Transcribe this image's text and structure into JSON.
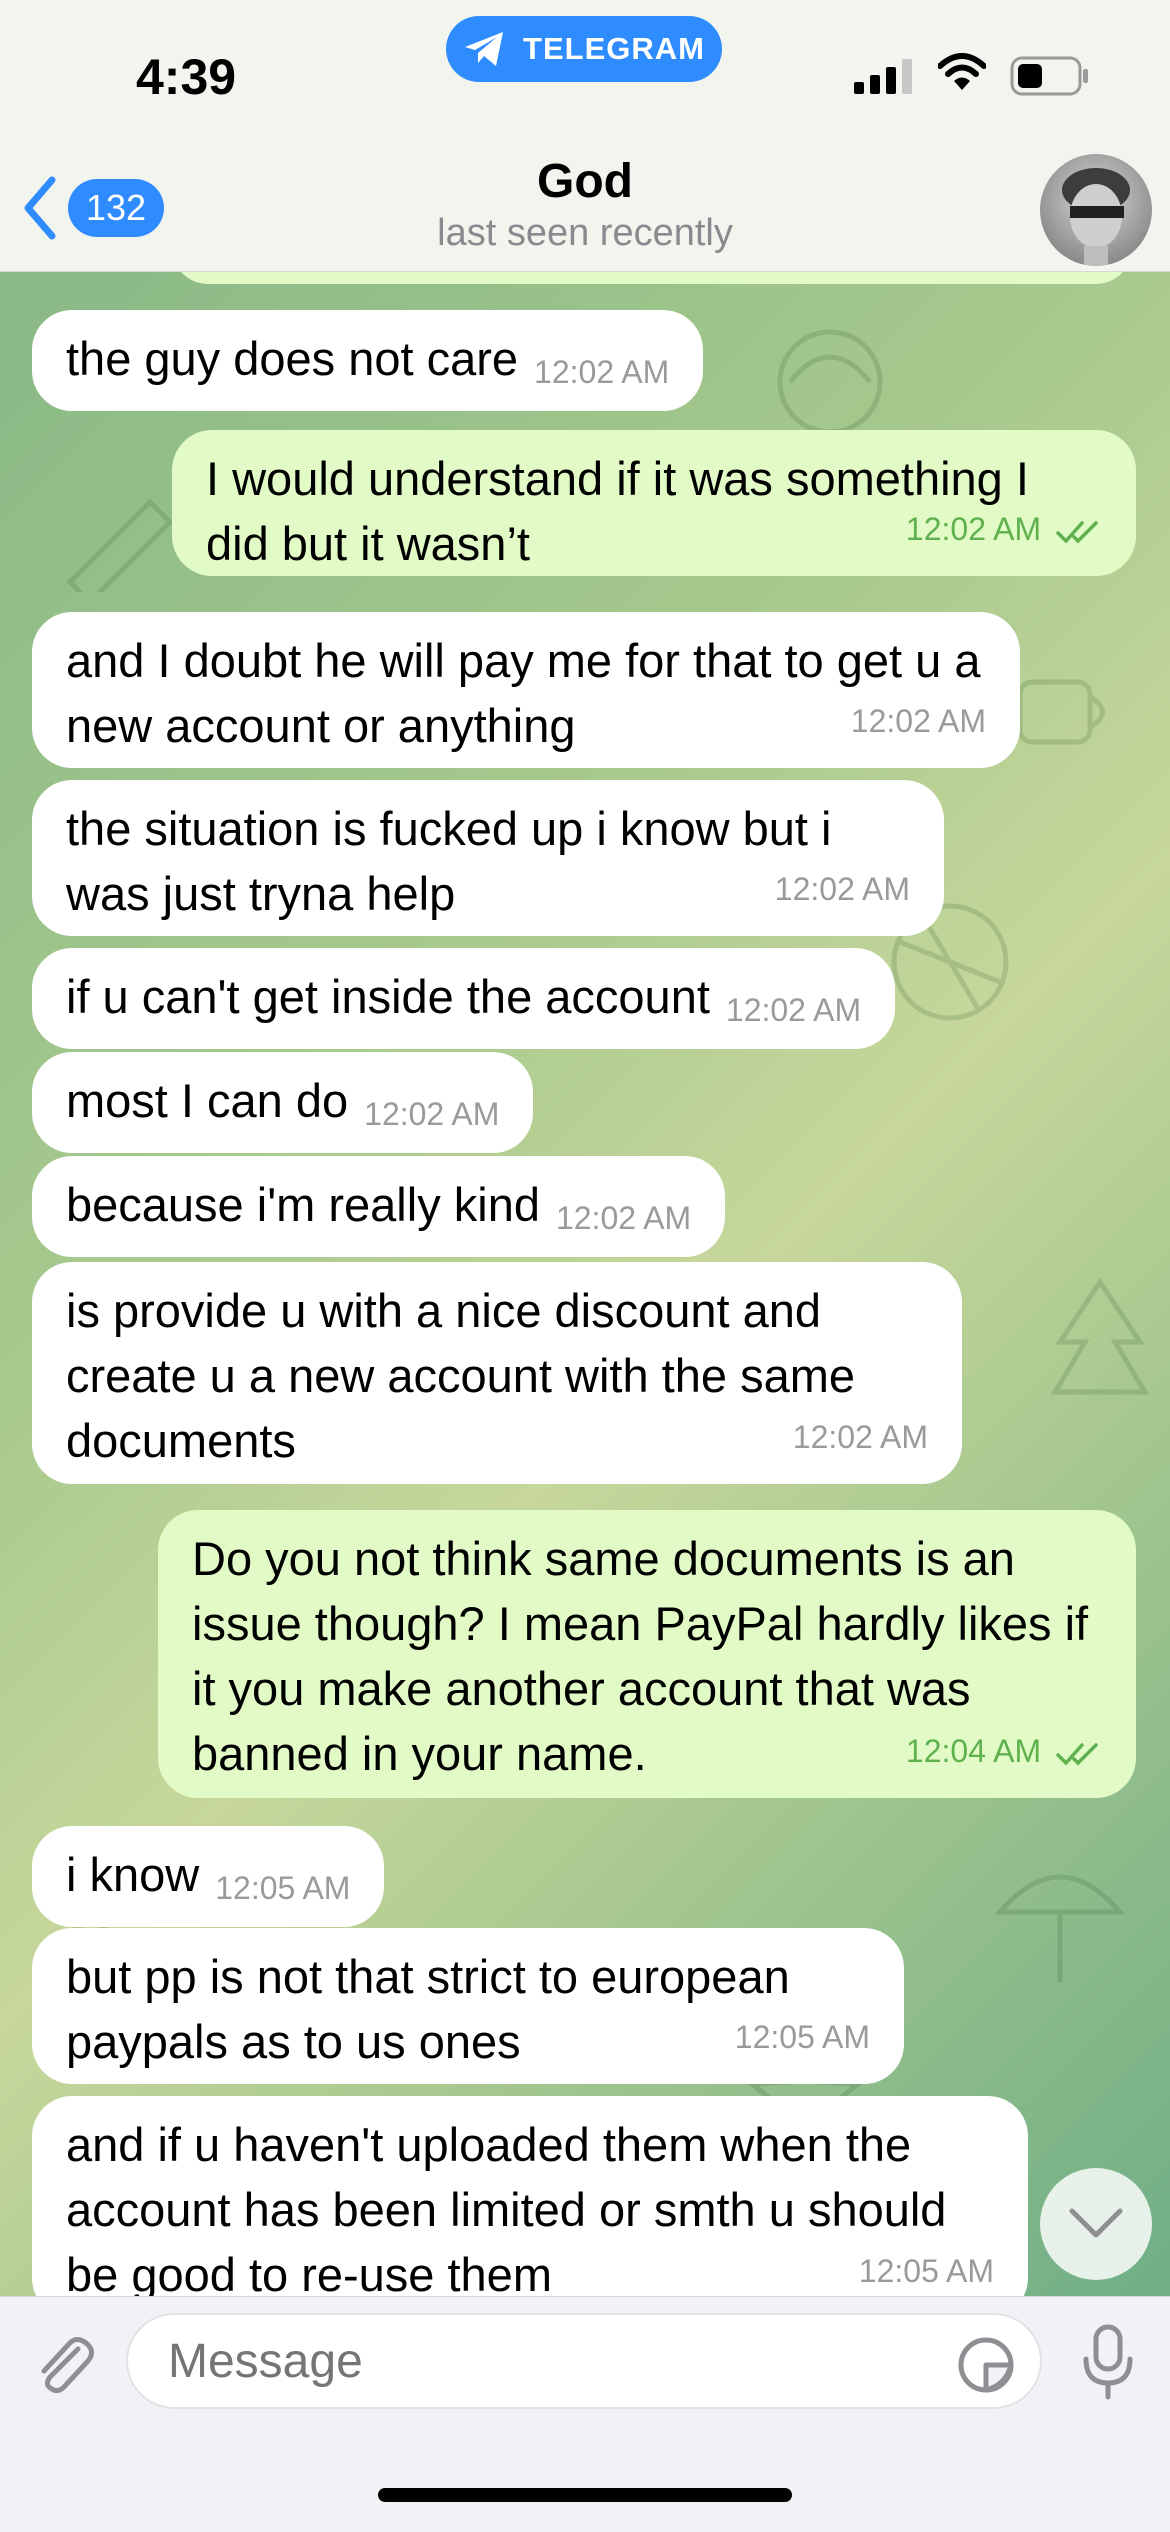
{
  "status_bar": {
    "time": "4:39",
    "pill_label": "TELEGRAM"
  },
  "header": {
    "back_count": "132",
    "title": "God",
    "subtitle": "last seen recently"
  },
  "messages": [
    {
      "dir": "in",
      "text": "the guy does not care",
      "time": "12:02 AM"
    },
    {
      "dir": "out",
      "text": "I would understand if it was something I did but it wasn’t",
      "time": "12:02 AM"
    },
    {
      "dir": "in",
      "text": "and I doubt he will pay me for that to get u a new account or anything",
      "time": "12:02 AM"
    },
    {
      "dir": "in",
      "text": "the situation is fucked up i know but i was just tryna help",
      "time": "12:02 AM"
    },
    {
      "dir": "in",
      "text": "if u can't get inside the account",
      "time": "12:02 AM"
    },
    {
      "dir": "in",
      "text": "most I can do",
      "time": "12:02 AM"
    },
    {
      "dir": "in",
      "text": "because i'm really kind",
      "time": "12:02 AM"
    },
    {
      "dir": "in",
      "text": "is provide u with a nice discount and create u a new account with the same documents",
      "time": "12:02 AM"
    },
    {
      "dir": "out",
      "text": "Do you not think same documents is an issue though? I mean PayPal hardly likes if it you make another account that was banned in your name.",
      "time": "12:04 AM"
    },
    {
      "dir": "in",
      "text": "i know",
      "time": "12:05 AM"
    },
    {
      "dir": "in",
      "text": "but pp is not that strict to european paypals as to us ones",
      "time": "12:05 AM"
    },
    {
      "dir": "in",
      "text": "and if u haven't uploaded them when the account has been limited or smth u should be good to re-use them",
      "time": "12:05 AM"
    }
  ],
  "input": {
    "placeholder": "Message"
  },
  "colors": {
    "accent": "#2f8cff",
    "incoming_bubble": "#ffffff",
    "outgoing_bubble": "#e2fbc6",
    "outgoing_meta": "#5fb04f"
  },
  "icons": {
    "pill": "telegram-plane-icon",
    "back": "chevron-left-icon",
    "attach": "paperclip-icon",
    "sticker": "sticker-icon",
    "mic": "microphone-icon",
    "scroll": "chevron-down-icon",
    "read": "double-check-icon"
  }
}
